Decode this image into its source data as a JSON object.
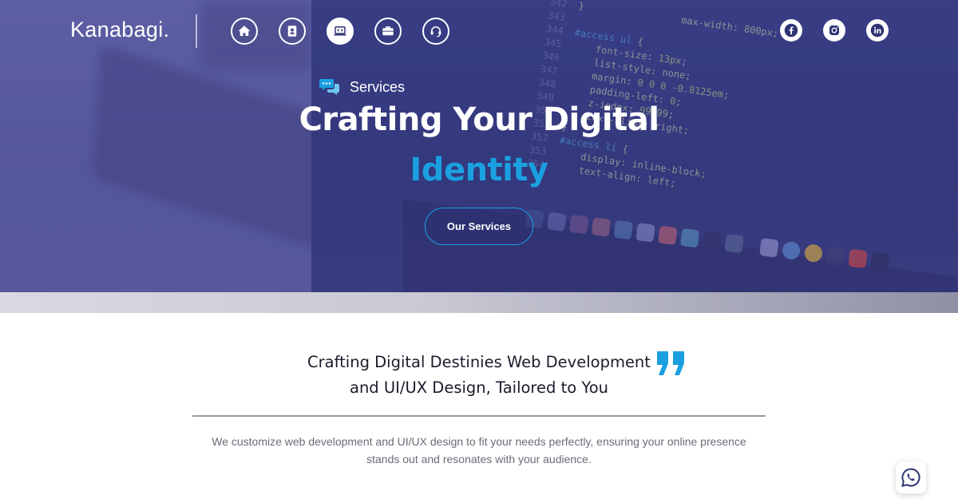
{
  "brand": {
    "name": "Kanabagi."
  },
  "nav": {
    "items": [
      {
        "icon": "home-icon",
        "active": false
      },
      {
        "icon": "contact-book-icon",
        "active": false
      },
      {
        "icon": "laptop-code-icon",
        "active": true
      },
      {
        "icon": "briefcase-icon",
        "active": false
      },
      {
        "icon": "headset-icon",
        "active": false
      }
    ]
  },
  "social": [
    {
      "icon": "facebook-icon"
    },
    {
      "icon": "instagram-icon"
    },
    {
      "icon": "linkedin-icon"
    }
  ],
  "hero": {
    "tag_icon": "chat-bubbles-icon",
    "tag": "Services",
    "title_line1": "Crafting Your Digital",
    "title_line2": "Identity",
    "cta": "Our Services"
  },
  "content": {
    "tagline_line1": "Crafting Digital Destinies Web Development",
    "tagline_line2": "and UI/UX Design, Tailored to You",
    "quote_icon": "quote-icon",
    "description": "We customize web development and UI/UX design to fit your needs perfectly, ensuring your online presence stands out and resonates with your audience."
  },
  "whatsapp": {
    "icon": "whatsapp-icon"
  },
  "colors": {
    "accent": "#1aa0e0",
    "hero_overlay": "#4a4a92",
    "text_dark": "#1b1b2b",
    "text_muted": "#6b6b78"
  }
}
